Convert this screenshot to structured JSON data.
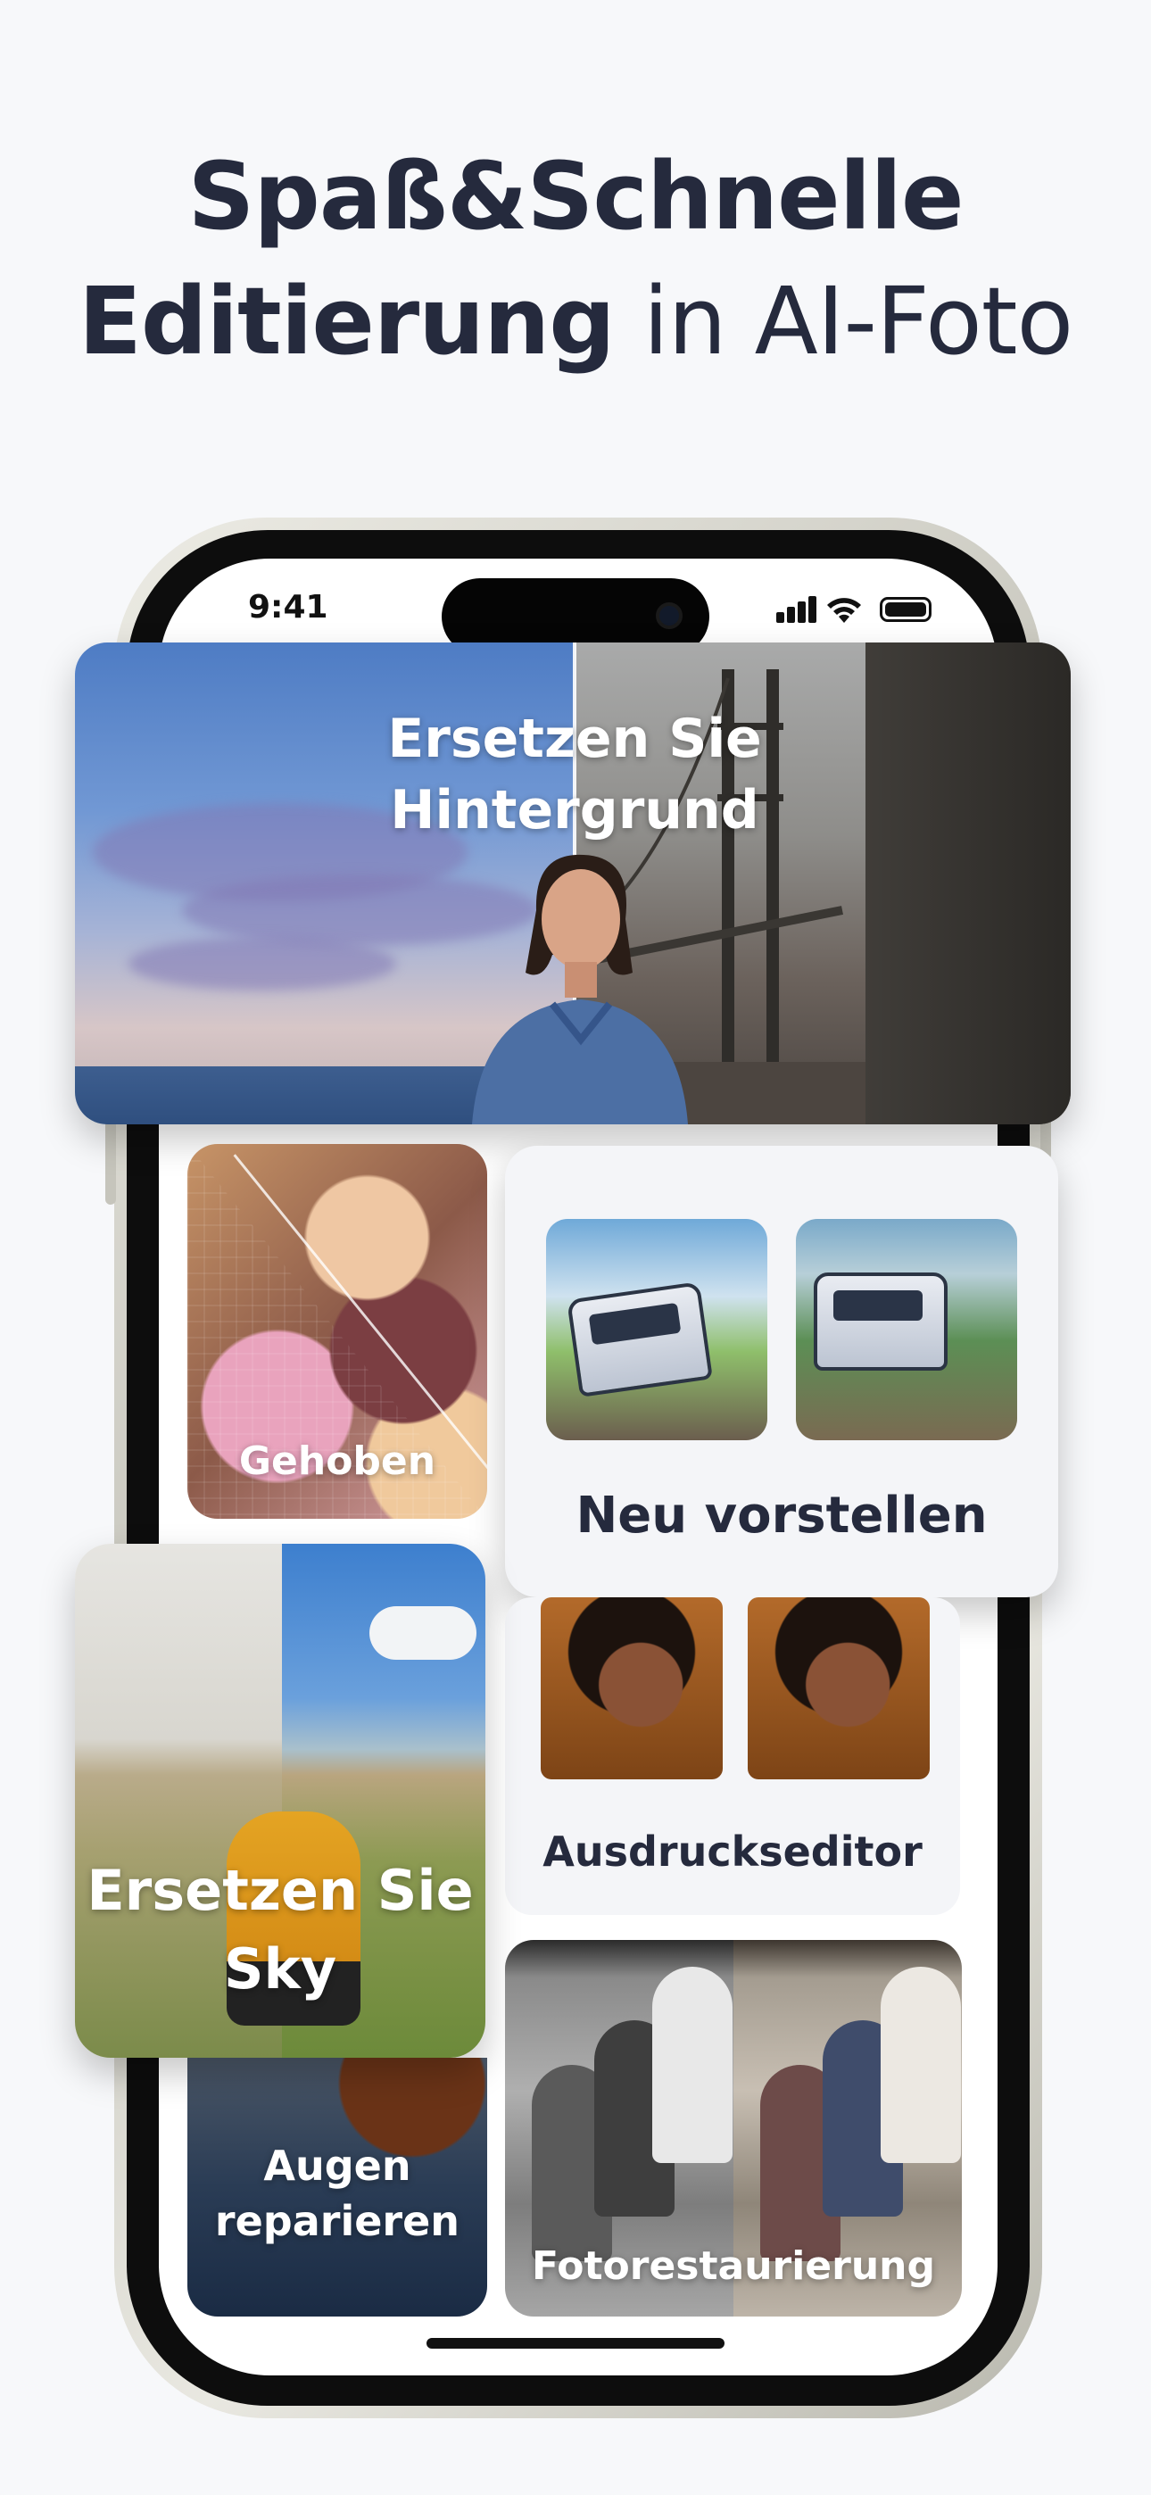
{
  "headline": {
    "line1": "Spaß&Schnelle",
    "line2_bold": "Editierung",
    "line2_rest": " in AI-Foto"
  },
  "status_bar": {
    "time": "9:41",
    "icons": [
      "signal-icon",
      "wifi-icon",
      "battery-icon"
    ]
  },
  "cards": {
    "hero": {
      "label": "Ersetzen Sie Hintergrund"
    },
    "upscale": {
      "label": "Gehoben"
    },
    "reimagine": {
      "label": "Neu vorstellen"
    },
    "expression": {
      "label": "Ausdruckseditor"
    },
    "sky": {
      "label": "Ersetzen Sie Sky"
    },
    "eyes": {
      "label": "Augen reparieren"
    },
    "restore": {
      "label": "Fotorestaurierung"
    }
  },
  "colors": {
    "background": "#f7f8fa",
    "headline": "#252a3d",
    "card_light": "#f4f5f8"
  }
}
